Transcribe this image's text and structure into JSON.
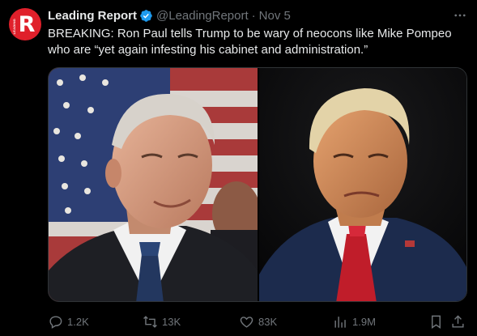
{
  "tweet": {
    "avatar": {
      "letter": "R",
      "side_text": "LEADING"
    },
    "author": {
      "display_name": "Leading Report",
      "handle": "@LeadingReport",
      "separator": "·",
      "date": "Nov 5",
      "verified": true
    },
    "text": "BREAKING: Ron Paul tells Trump to be wary of neocons like Mike Pompeo who are “yet again infesting his cabinet and administration.”",
    "media": [
      {
        "icon": "portrait-photo-left"
      },
      {
        "icon": "portrait-photo-right"
      }
    ],
    "actions": {
      "replies": "1.2K",
      "reposts": "13K",
      "likes": "83K",
      "views": "1.9M"
    }
  },
  "colors": {
    "background": "#000000",
    "text_primary": "#e7e9ea",
    "text_secondary": "#71767b",
    "verified_blue": "#1d9bf0",
    "avatar_red": "#e0202b",
    "border": "#2f3336"
  }
}
